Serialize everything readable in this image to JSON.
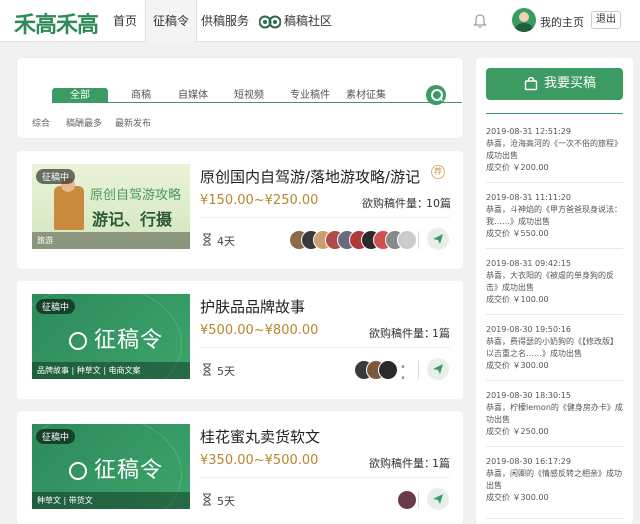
{
  "logo": "禾高禾高",
  "nav": {
    "items": [
      "首页",
      "征稿令",
      "供稿服务",
      "稿稿社区"
    ],
    "home_label": "我的主页",
    "logout_label": "退出"
  },
  "filter": {
    "tabs": [
      "全部",
      "商稿",
      "自媒体",
      "短视频",
      "专业稿件",
      "素材征集"
    ],
    "sort": [
      "综合",
      "稿酬最多",
      "最新发布"
    ]
  },
  "tasks": [
    {
      "badge": "征稿中",
      "thumb_lines": [
        "原创自驾游攻略",
        "游记、行摄"
      ],
      "tags": "旅游",
      "title": "原创国内自驾游/落地游攻略/游记",
      "price": "¥150.00~¥250.00",
      "wanted_label": "欲购稿件量：",
      "wanted": "10篇",
      "days": "4天",
      "medal": "荐"
    },
    {
      "badge": "征稿中",
      "thumb_lines": [
        "征稿令"
      ],
      "tags": "品牌故事 | 种草文 | 电商文案",
      "title": "护肤品品牌故事",
      "price": "¥500.00~¥800.00",
      "wanted_label": "欲购稿件量：",
      "wanted": "1篇",
      "days": "5天",
      "extra": "• •"
    },
    {
      "badge": "征稿中",
      "thumb_lines": [
        "征稿令"
      ],
      "tags": "种草文 | 带货文",
      "title": "桂花蜜丸卖货软文",
      "price": "¥350.00~¥500.00",
      "wanted_label": "欲购稿件量：",
      "wanted": "1篇",
      "days": "5天"
    }
  ],
  "sidebar": {
    "buy_label": "我要买稿",
    "feed": [
      {
        "time": "2019-08-31 12:51:29",
        "msg": "恭喜，沧海高河的《一次不俗的旅程》成功出售",
        "price": "成交价 ￥200.00"
      },
      {
        "time": "2019-08-31 11:11:20",
        "msg": "恭喜，斗神焰的《甲方爸爸现身说法：我……》成功出售",
        "price": "成交价 ￥550.00"
      },
      {
        "time": "2019-08-31 09:42:15",
        "msg": "恭喜，大衣阳的《被虐的单身狗的反击》成功出售",
        "price": "成交价 ￥100.00"
      },
      {
        "time": "2019-08-30 19:50:16",
        "msg": "恭喜，费得瑟的小奶狗的《【修改版】以吉重之名……》成功出售",
        "price": "成交价 ￥300.00"
      },
      {
        "time": "2019-08-30 18:30:15",
        "msg": "恭喜，柠檬lemon的《健身房办卡》成功出售",
        "price": "成交价 ￥250.00"
      },
      {
        "time": "2019-08-30 16:17:29",
        "msg": "恭喜，闲卿的《情感反转之相亲》成功出售",
        "price": "成交价 ￥300.00"
      }
    ]
  }
}
